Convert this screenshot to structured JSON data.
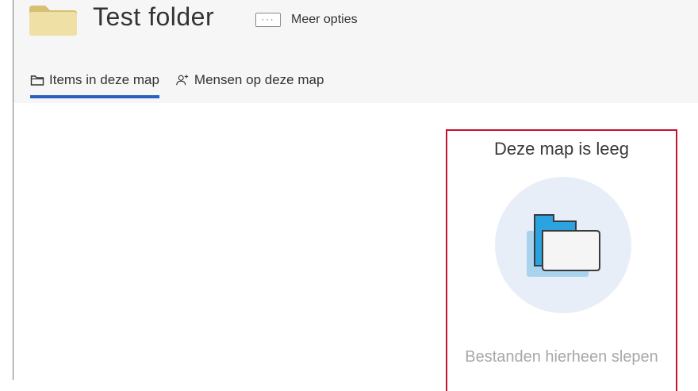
{
  "header": {
    "title": "Test folder",
    "more_options_label": "Meer opties",
    "more_options_icon": "ellipsis-icon",
    "folder_icon": "folder-icon",
    "background": "#f6f6f6"
  },
  "tabs": [
    {
      "label": "Items in deze map",
      "icon": "folder-outline-icon",
      "active": true
    },
    {
      "label": "Mensen op deze map",
      "icon": "add-person-icon",
      "active": false
    }
  ],
  "empty_state": {
    "title": "Deze map is leeg",
    "hint": "Bestanden hierheen slepen",
    "icon": "empty-folder-icon",
    "highlight_color": "#c8102e"
  },
  "colors": {
    "accent": "#2d5fbf",
    "folder_tan": "#e7d28f",
    "folder_blue": "#2aa3e0"
  }
}
